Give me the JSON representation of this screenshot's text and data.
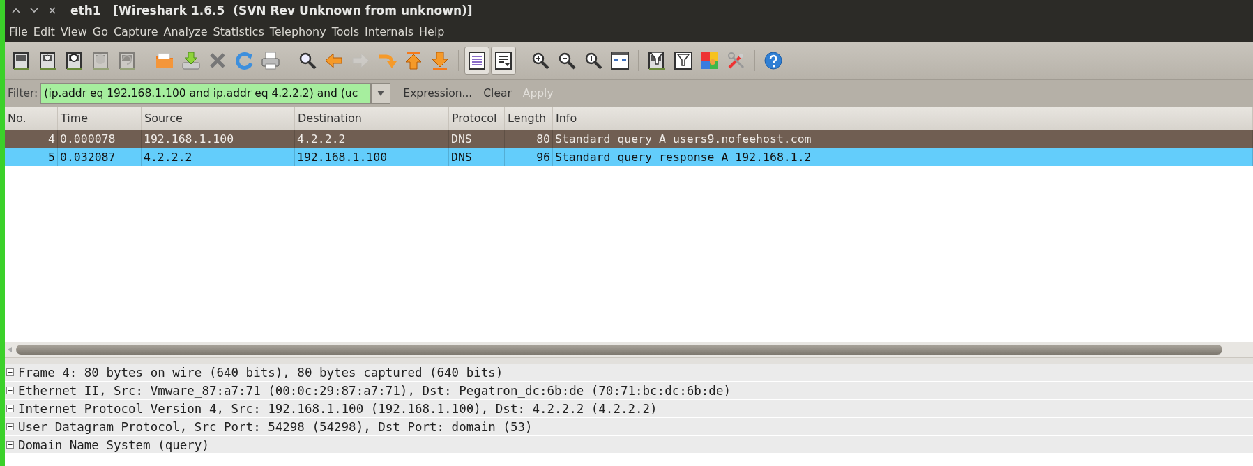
{
  "window": {
    "title": "eth1   [Wireshark 1.6.5  (SVN Rev Unknown from unknown)]"
  },
  "menu": [
    "File",
    "Edit",
    "View",
    "Go",
    "Capture",
    "Analyze",
    "Statistics",
    "Telephony",
    "Tools",
    "Internals",
    "Help"
  ],
  "toolbar": [
    {
      "kind": "interfaces",
      "disabled": false,
      "on": false
    },
    {
      "kind": "options",
      "disabled": false,
      "on": false
    },
    {
      "kind": "start",
      "disabled": false,
      "on": false
    },
    {
      "kind": "stop",
      "disabled": true,
      "on": false
    },
    {
      "kind": "restart",
      "disabled": true,
      "on": false
    },
    {
      "kind": "separator"
    },
    {
      "kind": "open",
      "disabled": false,
      "on": false
    },
    {
      "kind": "save",
      "disabled": false,
      "on": false
    },
    {
      "kind": "close",
      "disabled": false,
      "on": false
    },
    {
      "kind": "reload",
      "disabled": false,
      "on": false
    },
    {
      "kind": "print",
      "disabled": false,
      "on": false
    },
    {
      "kind": "separator"
    },
    {
      "kind": "find",
      "disabled": false,
      "on": false
    },
    {
      "kind": "back",
      "disabled": false,
      "on": false
    },
    {
      "kind": "forward",
      "disabled": true,
      "on": false
    },
    {
      "kind": "goto",
      "disabled": false,
      "on": false
    },
    {
      "kind": "first",
      "disabled": false,
      "on": false
    },
    {
      "kind": "last",
      "disabled": false,
      "on": false
    },
    {
      "kind": "separator"
    },
    {
      "kind": "colorize",
      "disabled": false,
      "on": true
    },
    {
      "kind": "autoscroll",
      "disabled": false,
      "on": true
    },
    {
      "kind": "separator"
    },
    {
      "kind": "zoomin",
      "disabled": false,
      "on": false
    },
    {
      "kind": "zoomout",
      "disabled": false,
      "on": false
    },
    {
      "kind": "zoomreset",
      "disabled": false,
      "on": false
    },
    {
      "kind": "resize",
      "disabled": false,
      "on": false
    },
    {
      "kind": "separator"
    },
    {
      "kind": "capfilter",
      "disabled": false,
      "on": false
    },
    {
      "kind": "dispfilter",
      "disabled": false,
      "on": false
    },
    {
      "kind": "coloring",
      "disabled": false,
      "on": false
    },
    {
      "kind": "prefs",
      "disabled": false,
      "on": false
    },
    {
      "kind": "separator"
    },
    {
      "kind": "help",
      "disabled": false,
      "on": false
    }
  ],
  "filter": {
    "label": "Filter:",
    "value": "(ip.addr eq 192.168.1.100 and ip.addr eq 4.2.2.2) and (uc",
    "valid": true,
    "buttons": [
      {
        "label": "Expression...",
        "disabled": false
      },
      {
        "label": "Clear",
        "disabled": false
      },
      {
        "label": "Apply",
        "disabled": true
      }
    ]
  },
  "packet_list": {
    "columns": [
      "No.",
      "Time",
      "Source",
      "Destination",
      "Protocol",
      "Length",
      "Info"
    ],
    "rows": [
      {
        "cells": [
          "4",
          "0.000078",
          "192.168.1.100",
          "4.2.2.2",
          "DNS",
          "80",
          "Standard query A users9.nofeehost.com"
        ],
        "selected": false,
        "highlighted": true
      },
      {
        "cells": [
          "5",
          "0.032087",
          "4.2.2.2",
          "192.168.1.100",
          "DNS",
          "96",
          "Standard query response A 192.168.1.2"
        ],
        "selected": true,
        "highlighted": false
      }
    ]
  },
  "details": [
    {
      "text": "Frame 4: 80 bytes on wire (640 bits), 80 bytes captured (640 bits)",
      "expanded": false
    },
    {
      "text": "Ethernet II, Src: Vmware_87:a7:71 (00:0c:29:87:a7:71), Dst: Pegatron_dc:6b:de (70:71:bc:dc:6b:de)",
      "expanded": false
    },
    {
      "text": "Internet Protocol Version 4, Src: 192.168.1.100 (192.168.1.100), Dst: 4.2.2.2 (4.2.2.2)",
      "expanded": false
    },
    {
      "text": "User Datagram Protocol, Src Port: 54298 (54298), Dst Port: domain (53)",
      "expanded": false
    },
    {
      "text": "Domain Name System (query)",
      "expanded": false
    }
  ]
}
